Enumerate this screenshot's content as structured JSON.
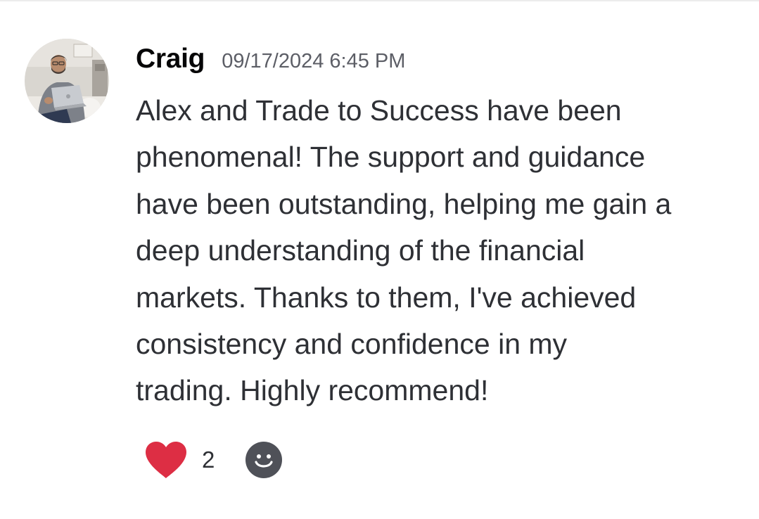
{
  "message": {
    "author": "Craig",
    "timestamp": "09/17/2024 6:45 PM",
    "content": "Alex and Trade to Success have been\nphenomenal! The support and guidance\nhave been outstanding, helping me gain a\ndeep understanding of the financial\nmarkets. Thanks to them, I've achieved\nconsistency and confidence in my\ntrading. Highly recommend!",
    "avatar_icon": "user-avatar-photo"
  },
  "reactions": [
    {
      "emoji_icon": "heart-icon",
      "count": "2",
      "color": "#dd2e44"
    }
  ],
  "add_reaction_icon": "smiley-face-icon",
  "colors": {
    "author": "#060607",
    "timestamp": "#5c5e66",
    "text": "#2e3035",
    "add_reaction_bg": "#4f5158"
  }
}
